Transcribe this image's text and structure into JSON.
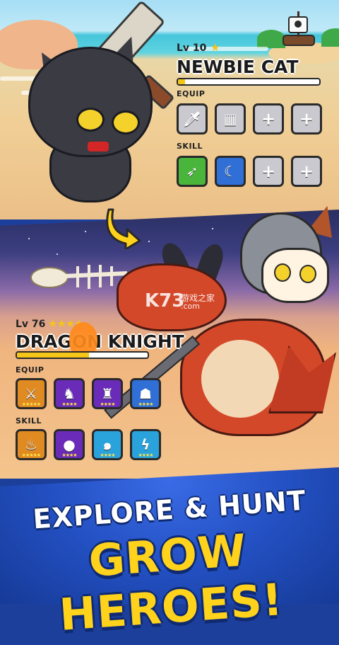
{
  "hero_top": {
    "level": "Lv 10",
    "stars": "★",
    "name": "NEWBIE CAT",
    "xp_fraction": 0.05,
    "equip_label": "EQUIP",
    "skill_label": "SKILL",
    "equip_slots": [
      {
        "icon": "dagger-icon",
        "glyph": "🗡",
        "color": "grey"
      },
      {
        "icon": "wooden-shield-icon",
        "glyph": "▥",
        "color": "grey"
      },
      {
        "icon": "empty-slot-icon",
        "glyph": "+",
        "color": "empty"
      },
      {
        "icon": "empty-slot-icon",
        "glyph": "+",
        "color": "empty"
      }
    ],
    "skill_slots": [
      {
        "icon": "throwing-knives-icon",
        "glyph": "➶",
        "color": "green"
      },
      {
        "icon": "crescent-slash-icon",
        "glyph": "☾",
        "color": "blue"
      },
      {
        "icon": "empty-slot-icon",
        "glyph": "+",
        "color": "empty"
      },
      {
        "icon": "empty-slot-icon",
        "glyph": "+",
        "color": "empty"
      }
    ]
  },
  "hero_bottom": {
    "level": "Lv 76",
    "stars": "★★★★",
    "name": "DRAGON KNIGHT",
    "xp_fraction": 0.55,
    "equip_label": "EQUIP",
    "skill_label": "SKILL",
    "equip_slots": [
      {
        "icon": "fire-sword-icon",
        "glyph": "⚔",
        "color": "orange",
        "rating": "★★★★★"
      },
      {
        "icon": "crimson-armor-icon",
        "glyph": "♞",
        "color": "purple",
        "rating": "★★★★"
      },
      {
        "icon": "demon-helm-icon",
        "glyph": "♜",
        "color": "purple",
        "rating": "★★★★"
      },
      {
        "icon": "dragon-mask-icon",
        "glyph": "☗",
        "color": "blue",
        "rating": "★★★★"
      }
    ],
    "skill_slots": [
      {
        "icon": "dragon-breath-icon",
        "glyph": "♨",
        "color": "orange",
        "rating": "★★★★★"
      },
      {
        "icon": "fireball-icon",
        "glyph": "●",
        "color": "purple",
        "rating": "★★★★"
      },
      {
        "icon": "tornado-icon",
        "glyph": "๑",
        "color": "cyan",
        "rating": "★★★★"
      },
      {
        "icon": "lightning-icon",
        "glyph": "ϟ",
        "color": "cyan",
        "rating": "★★★★"
      }
    ]
  },
  "watermark": {
    "logo": "K73",
    "text": "游戏之家",
    "url": ".com"
  },
  "tagline": {
    "line1": "EXPLORE & HUNT",
    "line2": "GROW HEROES!"
  },
  "colors": {
    "xp_fill": "#f5c518",
    "tagline_yellow": "#ffd21c",
    "footer_blue": "#2350c2"
  }
}
